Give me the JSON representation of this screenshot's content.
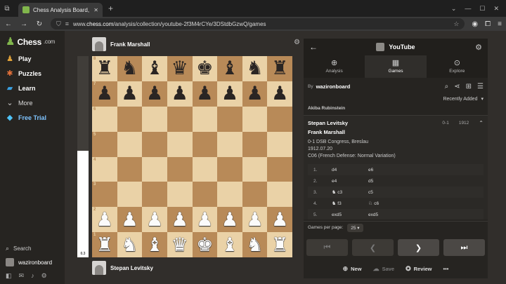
{
  "browser": {
    "tab_title": "Chess Analysis Board, Game",
    "url_prefix": "www.",
    "url_domain": "chess.com",
    "url_path": "/analysis/collection/youtube-2f3M4rCYe/3DStdbGzwQ/games"
  },
  "sidebar": {
    "logo": "Chess",
    "logo_suffix": ".com",
    "items": [
      {
        "label": "Play",
        "icon": "play-icon",
        "color": "#e0a23a"
      },
      {
        "label": "Puzzles",
        "icon": "puzzle-icon",
        "color": "#e2703a"
      },
      {
        "label": "Learn",
        "icon": "learn-icon",
        "color": "#3aa0e2"
      },
      {
        "label": "More",
        "icon": "chevron-down-icon",
        "color": "#cccccc"
      },
      {
        "label": "Free Trial",
        "icon": "diamond-icon",
        "color": "#4fc3f7"
      }
    ],
    "search_label": "Search",
    "username": "wazironboard"
  },
  "board": {
    "top_player": "Frank Marshall",
    "bottom_player": "Stepan Levitsky",
    "eval_score": "0.3",
    "ranks": [
      "8",
      "7",
      "6",
      "5",
      "4",
      "3",
      "2",
      "1"
    ],
    "position": [
      [
        "r",
        "n",
        "b",
        "q",
        "k",
        "b",
        "n",
        "r"
      ],
      [
        "p",
        "p",
        "p",
        "p",
        "p",
        "p",
        "p",
        "p"
      ],
      [
        "",
        "",
        "",
        "",
        "",
        "",
        "",
        ""
      ],
      [
        "",
        "",
        "",
        "",
        "",
        "",
        "",
        ""
      ],
      [
        "",
        "",
        "",
        "",
        "",
        "",
        "",
        ""
      ],
      [
        "",
        "",
        "",
        "",
        "",
        "",
        "",
        ""
      ],
      [
        "P",
        "P",
        "P",
        "P",
        "P",
        "P",
        "P",
        "P"
      ],
      [
        "R",
        "N",
        "B",
        "Q",
        "K",
        "B",
        "N",
        "R"
      ]
    ]
  },
  "panel": {
    "title": "YouTube",
    "tabs": [
      {
        "label": "Analysis",
        "icon": "magnifier-icon"
      },
      {
        "label": "Games",
        "icon": "games-icon"
      },
      {
        "label": "Explore",
        "icon": "compass-icon"
      }
    ],
    "by_label": "By",
    "by_user": "wazironboard",
    "sort_label": "Recently Added",
    "prev_game_player": "Akiba Rubinstein",
    "game": {
      "white": "Stepan Levitsky",
      "black": "Frank Marshall",
      "result": "0-1",
      "year": "1912",
      "event": "0-1 DSB Congress, Breslau",
      "date": "1912.07.20",
      "opening": "C06 (French Defense: Normal Variation)",
      "moves": [
        {
          "n": "1.",
          "w": "d4",
          "w_piece": "",
          "b": "e6",
          "b_piece": ""
        },
        {
          "n": "2.",
          "w": "e4",
          "w_piece": "",
          "b": "d5",
          "b_piece": ""
        },
        {
          "n": "3.",
          "w": "c3",
          "w_piece": "♞",
          "b": "c5",
          "b_piece": ""
        },
        {
          "n": "4.",
          "w": "f3",
          "w_piece": "♞",
          "b": "c6",
          "b_piece": "♘"
        },
        {
          "n": "5.",
          "w": "exd5",
          "w_piece": "",
          "b": "exd5",
          "b_piece": ""
        }
      ]
    },
    "per_page_label": "Games per page:",
    "per_page_value": "25",
    "actions": {
      "new": "New",
      "save": "Save",
      "review": "Review",
      "more": "•••"
    }
  }
}
